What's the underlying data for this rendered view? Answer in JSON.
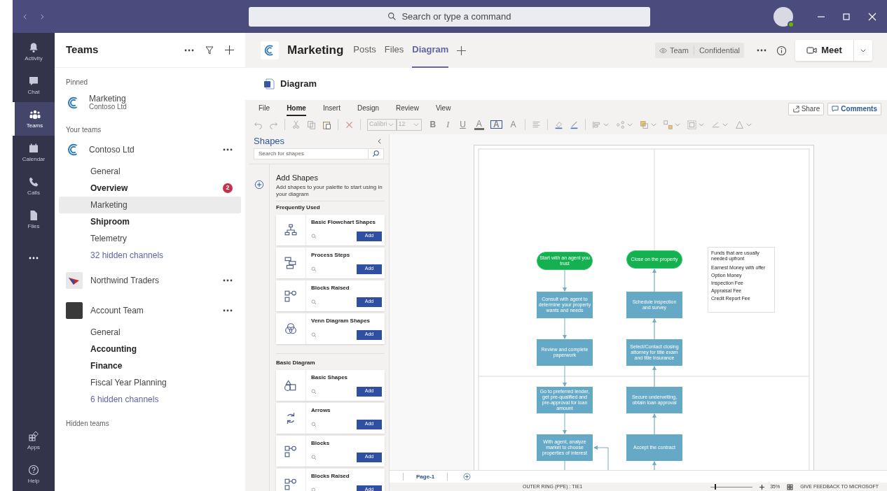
{
  "title_bar": {
    "search_placeholder": "Search or type a command"
  },
  "app_bar": {
    "items": [
      {
        "label": "Activity",
        "selected": false
      },
      {
        "label": "Chat",
        "selected": false
      },
      {
        "label": "Teams",
        "selected": true
      },
      {
        "label": "Calendar",
        "selected": false
      },
      {
        "label": "Calls",
        "selected": false
      },
      {
        "label": "Files",
        "selected": false
      }
    ],
    "bottom_items": [
      {
        "label": "Apps"
      },
      {
        "label": "Help"
      }
    ]
  },
  "teams_panel": {
    "title": "Teams",
    "pinned_heading": "Pinned",
    "pinned": [
      {
        "channel": "Marketing",
        "team": "Contoso Ltd"
      }
    ],
    "your_teams_heading": "Your teams",
    "teams": [
      {
        "name": "Contoso Ltd",
        "channels": [
          {
            "name": "General",
            "unread": false,
            "selected": false
          },
          {
            "name": "Overview",
            "unread": true,
            "selected": false,
            "badge": "2"
          },
          {
            "name": "Marketing",
            "unread": false,
            "selected": true
          },
          {
            "name": "Shiproom",
            "unread": true,
            "selected": false
          },
          {
            "name": "Telemetry",
            "unread": false,
            "selected": false
          }
        ],
        "hidden_channels": "32 hidden channels"
      },
      {
        "name": "Northwind Traders"
      },
      {
        "name": "Account Team",
        "channels": [
          {
            "name": "General",
            "unread": false,
            "selected": false
          },
          {
            "name": "Accounting",
            "unread": true,
            "selected": false
          },
          {
            "name": "Finance",
            "unread": true,
            "selected": false
          },
          {
            "name": "Fiscal Year Planning",
            "unread": false,
            "selected": false
          }
        ],
        "hidden_channels": "6 hidden channels"
      }
    ],
    "hidden_teams": "Hidden teams"
  },
  "channel_header": {
    "title": "Marketing",
    "tabs": [
      {
        "label": "Posts",
        "selected": false
      },
      {
        "label": "Files",
        "selected": false
      },
      {
        "label": "Diagram",
        "selected": true
      }
    ],
    "sensitivity": {
      "scope": "Team",
      "label": "Confidential"
    },
    "meet_button": "Meet"
  },
  "document": {
    "title": "Diagram"
  },
  "ribbon": {
    "tabs": [
      {
        "label": "File",
        "selected": false
      },
      {
        "label": "Home",
        "selected": true
      },
      {
        "label": "Insert",
        "selected": false
      },
      {
        "label": "Design",
        "selected": false
      },
      {
        "label": "Review",
        "selected": false
      },
      {
        "label": "View",
        "selected": false
      }
    ],
    "font": {
      "value": "Calibri",
      "disabled": true
    },
    "font_size": {
      "value": "12",
      "disabled": true
    },
    "text_buttons": [
      {
        "kind": "bold",
        "label": "B"
      },
      {
        "kind": "italic",
        "label": "I"
      },
      {
        "kind": "underline",
        "label": "U"
      },
      {
        "kind": "font_color",
        "label": "A"
      },
      {
        "kind": "text_box",
        "label": "A"
      },
      {
        "kind": "grow",
        "label": "A"
      }
    ],
    "share_button": "Share",
    "comments_button": "Comments"
  },
  "shapes_panel": {
    "title": "Shapes",
    "search_placeholder": "Search for shapes",
    "add_title": "Add Shapes",
    "add_text": "Add shapes to your palette to start using in your diagram",
    "sections": [
      {
        "title": "Frequently Used",
        "stencils": [
          {
            "name": "Basic Flowchart Shapes",
            "button": "Add"
          },
          {
            "name": "Process Steps",
            "button": "Add"
          },
          {
            "name": "Blocks Raised",
            "button": "Add"
          },
          {
            "name": "Venn Diagram Shapes",
            "button": "Add"
          }
        ]
      },
      {
        "title": "Basic Diagram",
        "stencils": [
          {
            "name": "Basic Shapes",
            "button": "Add"
          },
          {
            "name": "Arrows",
            "button": "Add"
          },
          {
            "name": "Blocks",
            "button": "Add"
          },
          {
            "name": "Blocks Raised",
            "button": "Add"
          }
        ]
      }
    ]
  },
  "diagram": {
    "columns": [
      {
        "nodes": [
          {
            "kind": "terminator",
            "text": "Start with an agent you trust"
          },
          {
            "kind": "process",
            "text": "Consult with agent to determine your property wants and needs"
          },
          {
            "kind": "process",
            "text": "Review and complete paperwork"
          },
          {
            "kind": "process",
            "text": "Go to preferred lender, get pre-qualified and pre-approval for loan amount"
          },
          {
            "kind": "process",
            "text": "With agent, analyze market to choose properties of interest"
          }
        ]
      },
      {
        "nodes": [
          {
            "kind": "terminator",
            "text": "Close on the property"
          },
          {
            "kind": "process",
            "text": "Schedule inspection and survey"
          },
          {
            "kind": "process",
            "text": "Select/Contact closing attorney for title exam and title insurance"
          },
          {
            "kind": "process",
            "text": "Secure underwriting, obtain loan approval"
          },
          {
            "kind": "process",
            "text": "Accept the contract"
          }
        ]
      }
    ],
    "note": {
      "title": "Funds that are usually needed upfront",
      "items": [
        "Earnest Money with offer",
        "Option Money",
        "Inspection Fee",
        "Appraisal Fee",
        "Credit Report Fee"
      ]
    }
  },
  "page_tabs": [
    {
      "label": "Page-1",
      "selected": true
    }
  ],
  "status_bar": {
    "text": "OUTER RING (PPE) : TIE1",
    "zoom": {
      "level": 0.1,
      "reading": "35%"
    },
    "feedback": "GIVE FEEDBACK TO MICROSOFT"
  }
}
